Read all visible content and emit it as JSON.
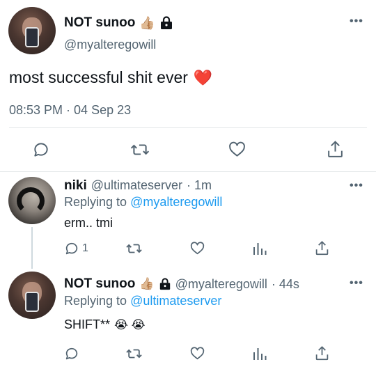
{
  "main_tweet": {
    "display_name": "NOT sunoo",
    "display_name_emoji": "👍🏼",
    "handle": "@myalteregowill",
    "text": "most successful shit ever",
    "text_emoji": "❤️",
    "timestamp": "08:53 PM · 04 Sep 23"
  },
  "replies": [
    {
      "display_name": "niki",
      "handle": "@ultimateserver",
      "time": "· 1m",
      "replying_prefix": "Replying to",
      "replying_to": "@myalteregowill",
      "text": "erm.. tmi",
      "reply_count": "1"
    },
    {
      "display_name": "NOT sunoo",
      "display_name_emoji": "👍🏼",
      "handle": "@myalteregowill",
      "time": "· 44s",
      "replying_prefix": "Replying to",
      "replying_to": "@ultimateserver",
      "text": "SHIFT**",
      "text_emoji": "😭 😭",
      "reply_count": ""
    }
  ],
  "icons": {
    "reply": "reply-icon",
    "retweet": "retweet-icon",
    "like": "heart-icon",
    "share": "share-icon",
    "views": "analytics-icon",
    "more": "more-icon",
    "protected": "lock-icon"
  },
  "colors": {
    "link": "#1d9bf0",
    "secondary_text": "#536471",
    "primary_text": "#0f1419",
    "divider": "#e6e9eb"
  }
}
